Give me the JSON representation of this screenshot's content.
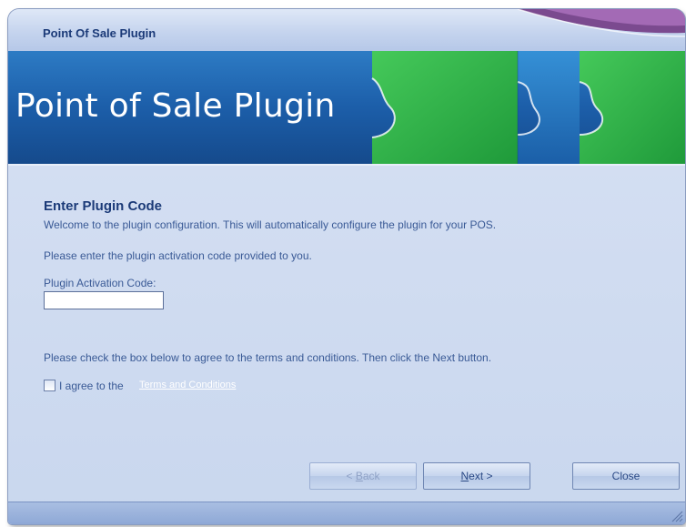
{
  "window": {
    "title": "Point Of Sale Plugin"
  },
  "banner": {
    "text": "Point of Sale Plugin"
  },
  "content": {
    "heading": "Enter Plugin Code",
    "welcome_text": "Welcome to the plugin configuration.  This will automatically configure the plugin for your POS.",
    "enter_code_text": "Please enter the plugin activation code provided to you.",
    "code_label": "Plugin Activation Code:",
    "code_value": "",
    "terms_instruction": "Please check the box below to agree to the terms and conditions.  Then click the Next button.",
    "agree_label": "I agree to the",
    "terms_link": "Terms and Conditions",
    "agree_checked": false
  },
  "buttons": {
    "back_label_pre": "< ",
    "back_label_underline": "B",
    "back_label_post": "ack",
    "next_label_underline": "N",
    "next_label_post": "ext >",
    "close_label": "Close"
  },
  "colors": {
    "accent": "#1b3a78",
    "text": "#3a5a96",
    "banner_blue": "#1a5fa8",
    "banner_green": "#2fb84a"
  },
  "icons": [
    "puzzle-piece-icon",
    "resize-grip-icon"
  ]
}
